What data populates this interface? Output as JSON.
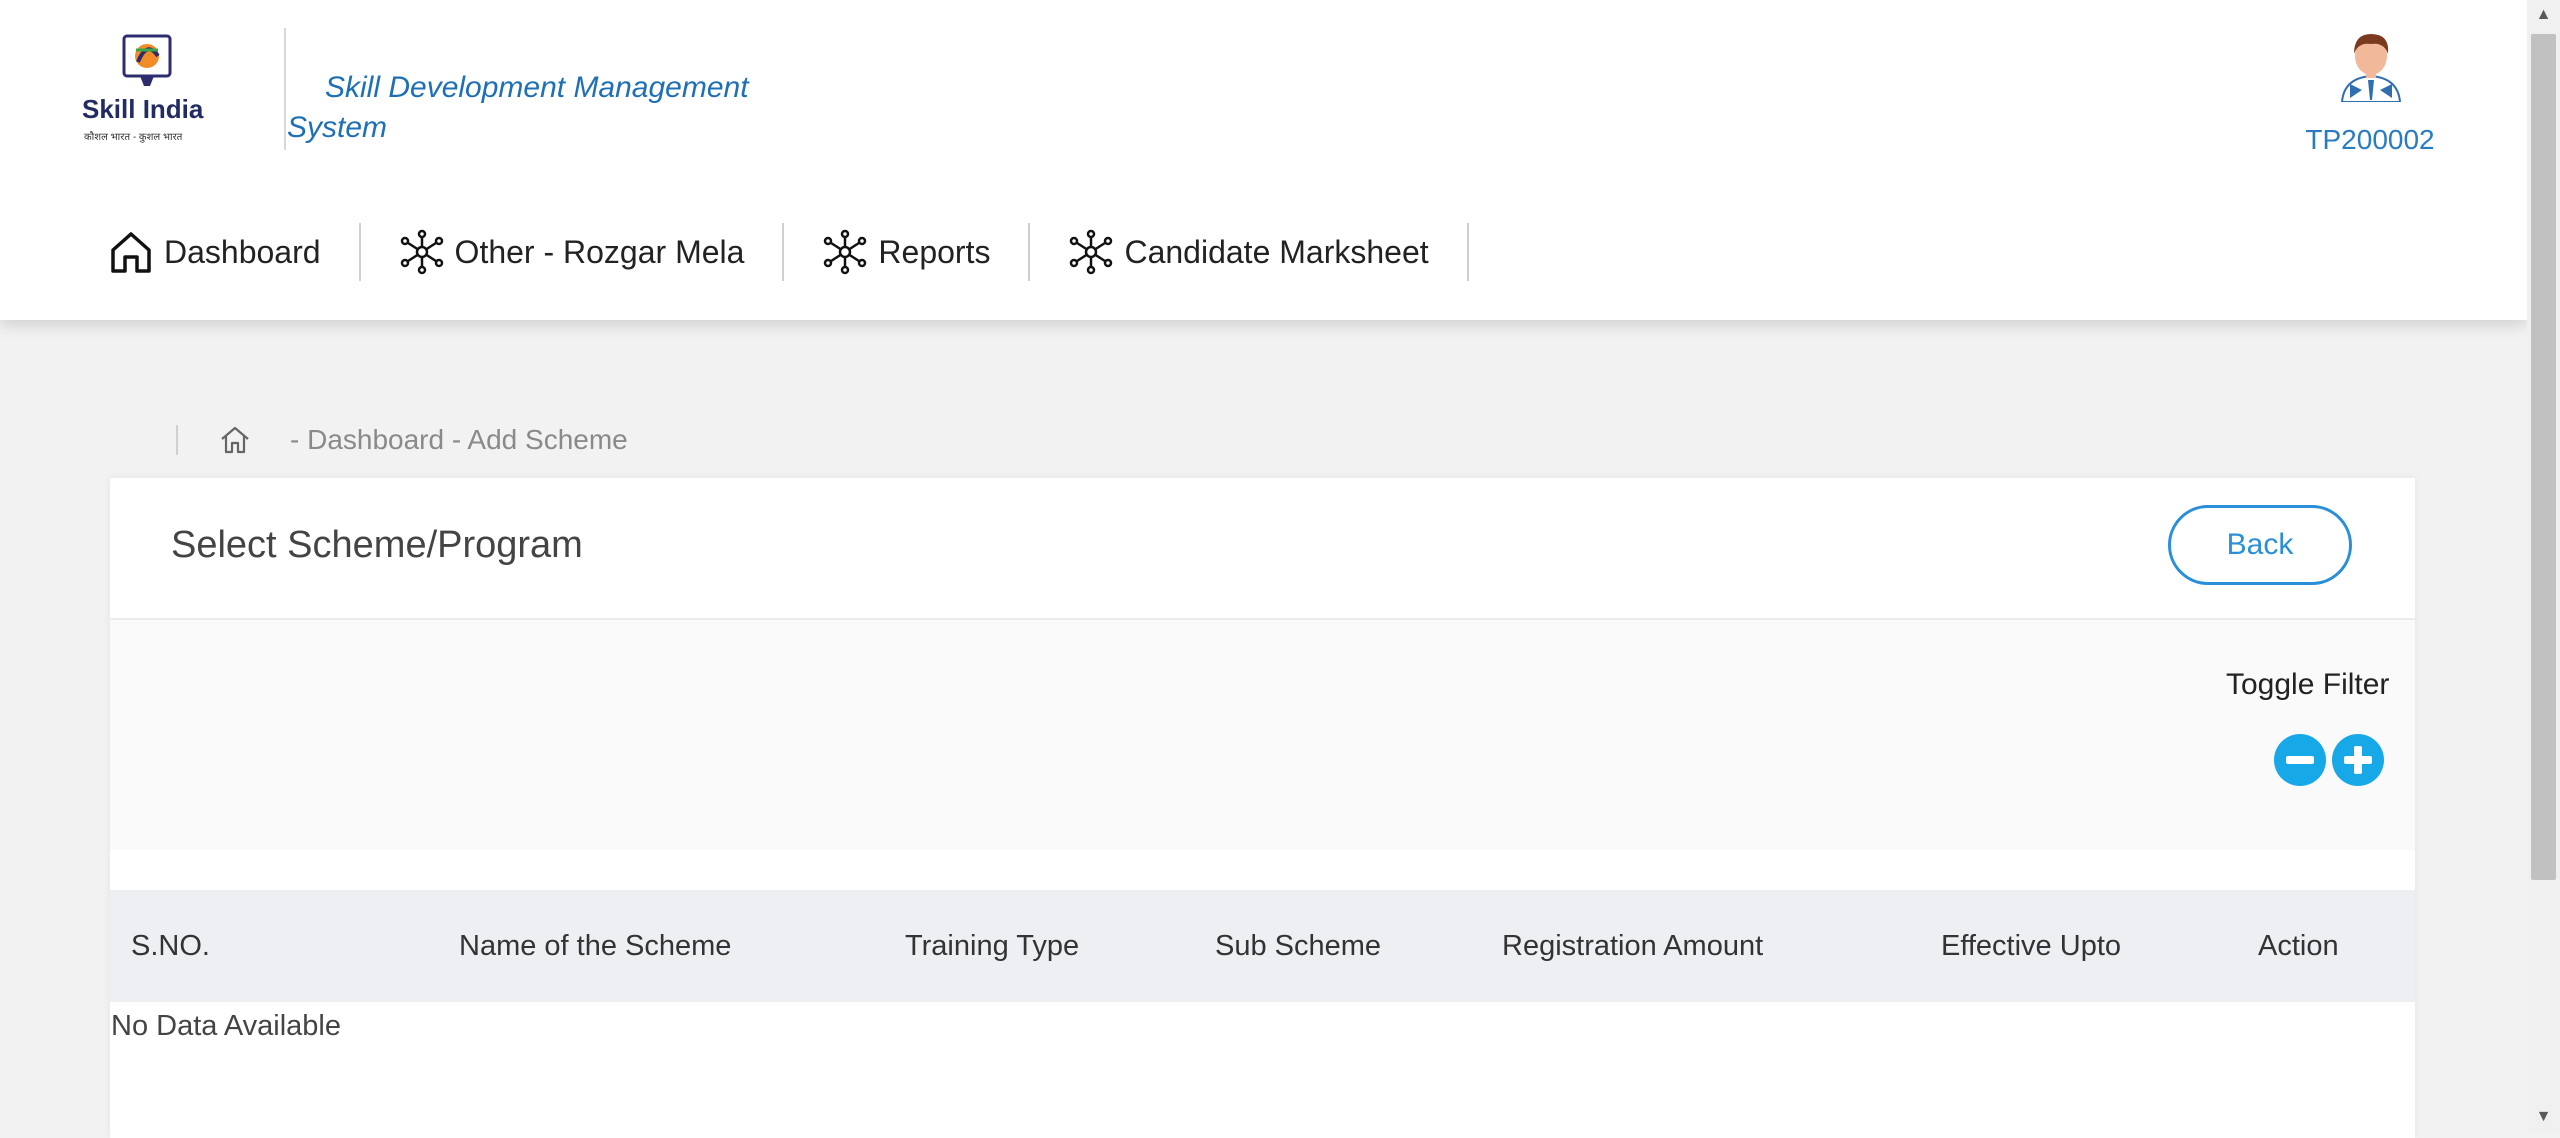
{
  "header": {
    "logo_text": "Skill India",
    "logo_subtext": "कौशल भारत - कुशल भारत",
    "app_title_line1": "Skill Development Management",
    "app_title_line2": "System",
    "user_id": "TP200002"
  },
  "nav": {
    "items": [
      {
        "label": "Dashboard",
        "icon": "home-icon"
      },
      {
        "label": "Other - Rozgar Mela",
        "icon": "network-icon"
      },
      {
        "label": "Reports",
        "icon": "network-icon"
      },
      {
        "label": "Candidate Marksheet",
        "icon": "network-icon"
      }
    ]
  },
  "breadcrumb": {
    "home_icon": "home-outline-icon",
    "path": "-  Dashboard - Add Scheme"
  },
  "card": {
    "title": "Select Scheme/Program",
    "back_label": "Back",
    "toggle_filter_label": "Toggle Filter"
  },
  "table": {
    "columns": [
      "S.NO.",
      "Name of the Scheme",
      "Training Type",
      "Sub Scheme",
      "Registration Amount",
      "Effective Upto",
      "Action"
    ],
    "rows": [],
    "empty_text": "No Data Available"
  },
  "colors": {
    "accent": "#2a8fd8",
    "toggle_button": "#17a8e8",
    "title_blue": "#1e6fb5"
  }
}
